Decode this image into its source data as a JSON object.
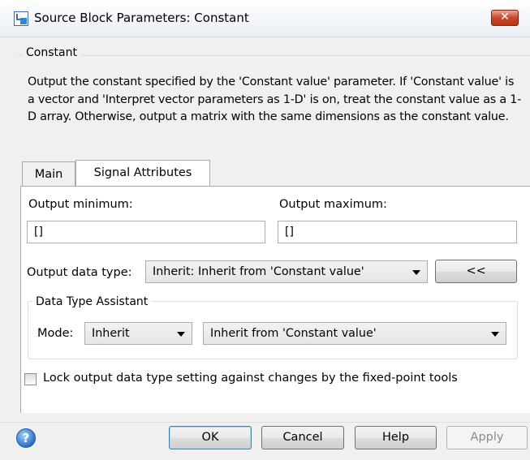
{
  "window": {
    "title": "Source Block Parameters: Constant",
    "close_label": "✕"
  },
  "description": {
    "group_title": "Constant",
    "text": "Output the constant specified by the 'Constant value' parameter. If 'Constant value' is a vector and 'Interpret vector parameters as 1-D' is on, treat the constant value as a 1-D array. Otherwise, output a matrix with the same dimensions as the constant value."
  },
  "tabs": [
    {
      "label": "Main",
      "active": false
    },
    {
      "label": "Signal Attributes",
      "active": true
    }
  ],
  "signal_attributes": {
    "output_min_label": "Output minimum:",
    "output_min_value": "[]",
    "output_max_label": "Output maximum:",
    "output_max_value": "[]",
    "data_type_label": "Output data type:",
    "data_type_value": "Inherit: Inherit from 'Constant value'",
    "assistant_toggle_label": "<<",
    "assistant": {
      "title": "Data Type Assistant",
      "mode_label": "Mode:",
      "mode_value": "Inherit",
      "inherit_value": "Inherit from 'Constant value'"
    },
    "lock_label": "Lock output data type setting against changes by the fixed-point tools",
    "lock_checked": false
  },
  "buttons": {
    "help_icon": "?",
    "ok": "OK",
    "cancel": "Cancel",
    "help": "Help",
    "apply": "Apply"
  },
  "colors": {
    "close_button": "#c9462c",
    "tab_panel": "#ffffff",
    "window_bg": "#f0f0f0"
  }
}
